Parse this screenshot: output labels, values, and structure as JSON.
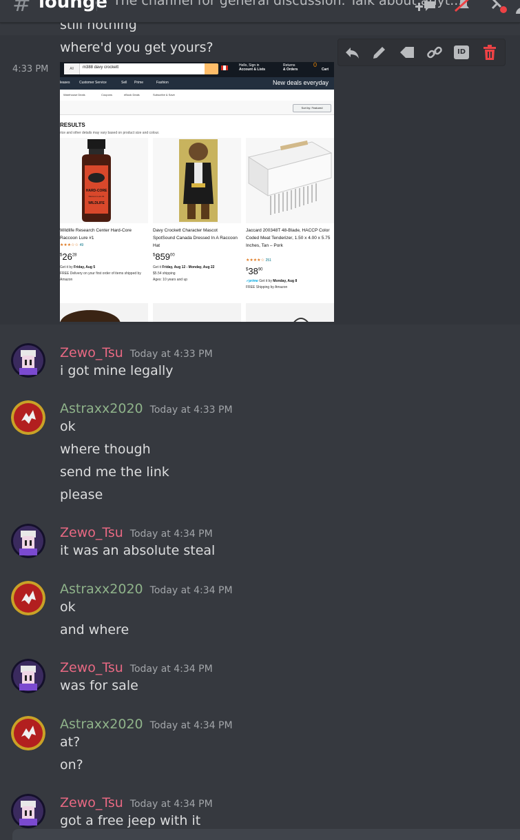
{
  "header": {
    "channel_name": "lounge",
    "topic": "The channel for general discussion. Talk about anyt...",
    "icons": [
      "hash-icon",
      "threads-icon",
      "mute-icon",
      "pins-icon",
      "members-icon"
    ]
  },
  "pre_messages": {
    "lines": [
      "still nothing",
      "where'd you get yours?"
    ],
    "hover_timestamp": "4:33 PM"
  },
  "hover_toolbar": {
    "icons": [
      "reply-icon",
      "edit-icon",
      "tag-icon",
      "link-icon",
      "id-icon",
      "trash-icon"
    ],
    "id_label": "ID"
  },
  "attachment": {
    "search_category": "All",
    "search_query": "m388 davy crockett",
    "account_line1": "Hello, Sign in",
    "account_line2": "Account & Lists",
    "returns_line1": "Returns",
    "returns_line2": "& Orders",
    "cart_count": "0",
    "cart_label": "Cart",
    "nav_items": [
      "leases",
      "Customer Service",
      "Sell",
      "Prime",
      "Fashion"
    ],
    "nav_deals": "New deals everyday",
    "sub_items": [
      "Warehouse Deals",
      "Coupons",
      "eBook Deals",
      "Subscribe & Save"
    ],
    "sort_label": "Sort by: Featured",
    "results_heading": "RESULTS",
    "results_sub": "rice and other details may vary based on product size and colour.",
    "products": [
      {
        "title": "Wildlife Research Center Hard-Core Raccoon Lure #1",
        "stars": "★★★☆☆",
        "rating_count": "49",
        "price_whole": "26",
        "price_frac": "28",
        "meta1_prefix": "Get it by ",
        "meta1_bold": "Friday, Aug 5",
        "meta2": "FREE Delivery on your first order of items shipped by Amazon",
        "label_top": "HARD-CORE",
        "label_mid": "Raccoon Lure #1",
        "label_bot": "WILDLIFE"
      },
      {
        "title": "Davy Crockett Character Mascot SpotSound Canada Dressed In A Raccoon Hat",
        "price_whole": "859",
        "price_frac": "00",
        "meta1_prefix": "Get it ",
        "meta1_bold": "Friday, Aug 12 - Monday, Aug 22",
        "meta2": "$5.54 shipping",
        "meta3": "Ages: 10 years and up"
      },
      {
        "title": "Jaccard 200348T 48-Blade, HACCP Color Coded Meat Tenderizer, 1.50 x 4.00 x 5.75 Inches, Tan – Pork",
        "stars": "★★★★☆",
        "rating_count": "251",
        "price_whole": "38",
        "price_frac": "90",
        "prime": "✓prime",
        "meta1_prefix": " Get it by ",
        "meta1_bold": "Monday, Aug 8",
        "meta2": "FREE Shipping by Amazon"
      }
    ]
  },
  "messages": [
    {
      "user": "Zewo_Tsu",
      "color": "#e96983",
      "time": "Today at 4:33 PM",
      "lines": [
        "i got mine legally"
      ]
    },
    {
      "user": "Astraxx2020",
      "color": "#8fb38a",
      "time": "Today at 4:33 PM",
      "lines": [
        "ok",
        "where though",
        "send me the link",
        "please"
      ]
    },
    {
      "user": "Zewo_Tsu",
      "color": "#e96983",
      "time": "Today at 4:34 PM",
      "lines": [
        "it was an absolute steal"
      ]
    },
    {
      "user": "Astraxx2020",
      "color": "#8fb38a",
      "time": "Today at 4:34 PM",
      "lines": [
        "ok",
        "and where"
      ]
    },
    {
      "user": "Zewo_Tsu",
      "color": "#e96983",
      "time": "Today at 4:34 PM",
      "lines": [
        "was for sale"
      ]
    },
    {
      "user": "Astraxx2020",
      "color": "#8fb38a",
      "time": "Today at 4:34 PM",
      "lines": [
        "at?",
        "on?"
      ]
    },
    {
      "user": "Zewo_Tsu",
      "color": "#e96983",
      "time": "Today at 4:34 PM",
      "lines": [
        "got a free jeep with it"
      ]
    }
  ],
  "colors": {
    "background": "#36393f",
    "zewo_name": "#e96983",
    "astraxx_name": "#8fb38a",
    "delete_red": "#ed4245"
  }
}
